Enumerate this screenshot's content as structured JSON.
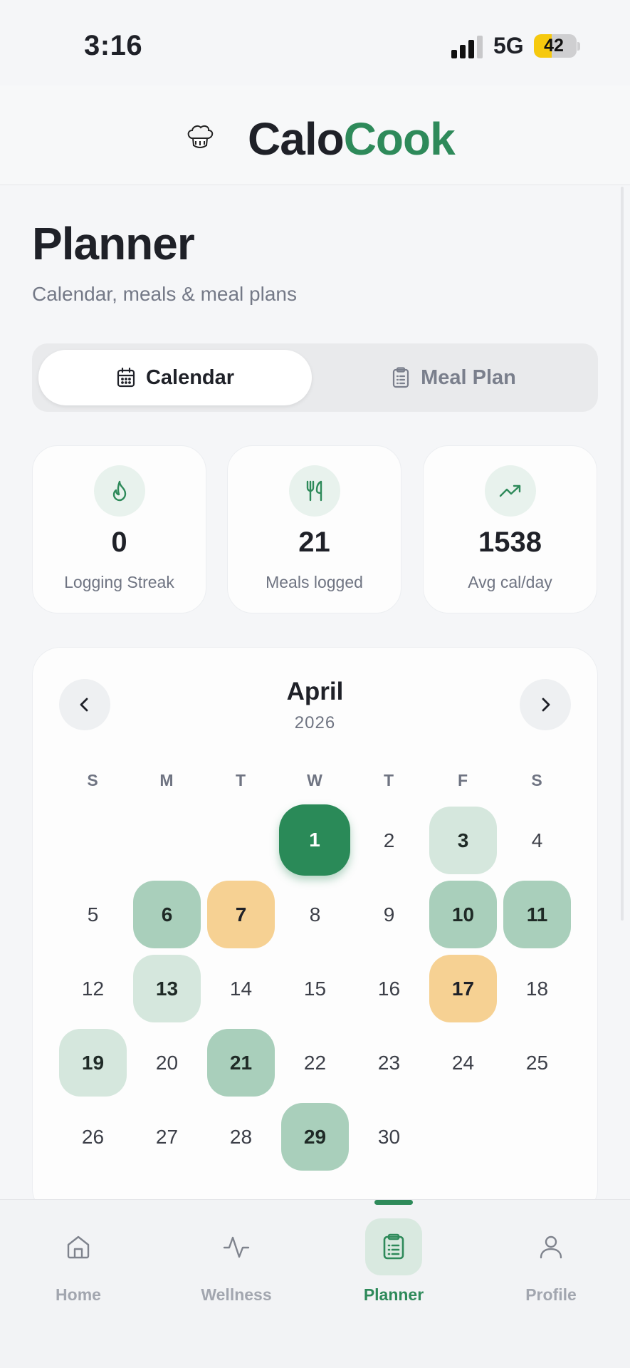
{
  "status_bar": {
    "time": "3:16",
    "network": "5G",
    "battery": "42",
    "battery_level": 0.42
  },
  "app": {
    "brand_part1": "Calo",
    "brand_part2": "Cook",
    "logo_icon": "chef-hat-icon"
  },
  "page": {
    "title": "Planner",
    "subtitle": "Calendar, meals & meal plans"
  },
  "tabs": [
    {
      "label": "Calendar",
      "icon": "calendar-icon",
      "active": true
    },
    {
      "label": "Meal Plan",
      "icon": "clipboard-icon",
      "active": false
    }
  ],
  "stats": [
    {
      "value": "0",
      "label": "Logging Streak",
      "icon": "flame-icon"
    },
    {
      "value": "21",
      "label": "Meals logged",
      "icon": "utensils-icon"
    },
    {
      "value": "1538",
      "label": "Avg cal/day",
      "icon": "trend-up-icon"
    }
  ],
  "calendar": {
    "month": "April",
    "year": "2026",
    "weekdays": [
      "S",
      "M",
      "T",
      "W",
      "T",
      "F",
      "S"
    ],
    "first_weekday_index": 3,
    "days": [
      {
        "d": "1",
        "s": "today"
      },
      {
        "d": "2",
        "s": ""
      },
      {
        "d": "3",
        "s": "lvl1"
      },
      {
        "d": "4",
        "s": ""
      },
      {
        "d": "5",
        "s": ""
      },
      {
        "d": "6",
        "s": "lvl2"
      },
      {
        "d": "7",
        "s": "warn"
      },
      {
        "d": "8",
        "s": ""
      },
      {
        "d": "9",
        "s": ""
      },
      {
        "d": "10",
        "s": "lvl2"
      },
      {
        "d": "11",
        "s": "lvl2"
      },
      {
        "d": "12",
        "s": ""
      },
      {
        "d": "13",
        "s": "lvl1"
      },
      {
        "d": "14",
        "s": ""
      },
      {
        "d": "15",
        "s": ""
      },
      {
        "d": "16",
        "s": ""
      },
      {
        "d": "17",
        "s": "warn"
      },
      {
        "d": "18",
        "s": ""
      },
      {
        "d": "19",
        "s": "lvl1"
      },
      {
        "d": "20",
        "s": ""
      },
      {
        "d": "21",
        "s": "lvl2"
      },
      {
        "d": "22",
        "s": ""
      },
      {
        "d": "23",
        "s": ""
      },
      {
        "d": "24",
        "s": ""
      },
      {
        "d": "25",
        "s": ""
      },
      {
        "d": "26",
        "s": ""
      },
      {
        "d": "27",
        "s": ""
      },
      {
        "d": "28",
        "s": ""
      },
      {
        "d": "29",
        "s": "lvl2"
      },
      {
        "d": "30",
        "s": ""
      }
    ]
  },
  "colors": {
    "accent": "#2e8a5a",
    "warn": "#f6d193",
    "low": "#d5e7dd",
    "high": "#a9cfbb"
  },
  "bottom_nav": [
    {
      "label": "Home",
      "icon": "home-icon",
      "active": false
    },
    {
      "label": "Wellness",
      "icon": "activity-icon",
      "active": false
    },
    {
      "label": "Planner",
      "icon": "clipboard-icon",
      "active": true
    },
    {
      "label": "Profile",
      "icon": "user-icon",
      "active": false
    }
  ]
}
